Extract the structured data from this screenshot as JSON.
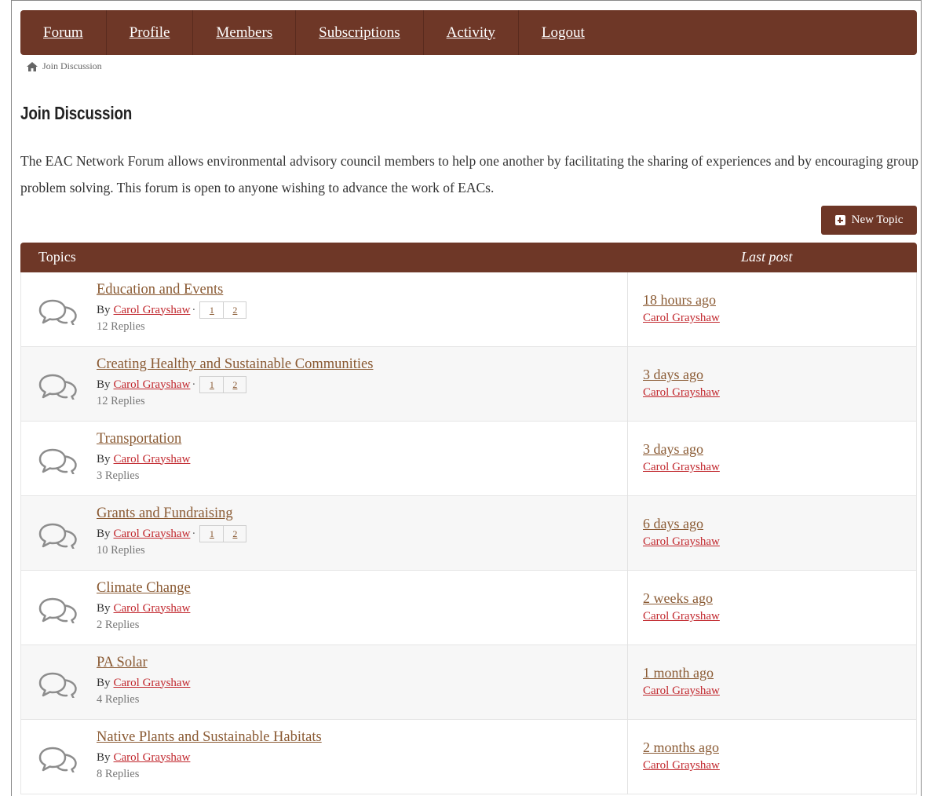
{
  "nav": {
    "items": [
      {
        "label": "Forum"
      },
      {
        "label": "Profile"
      },
      {
        "label": "Members"
      },
      {
        "label": "Subscriptions"
      },
      {
        "label": "Activity"
      },
      {
        "label": "Logout"
      }
    ]
  },
  "breadcrumb": {
    "icon": "home-icon",
    "label": "Join Discussion"
  },
  "page": {
    "title": "Join Discussion",
    "intro": "The EAC Network Forum allows environmental advisory council members to help one another by facilitating the sharing of experiences and by encouraging group problem solving. This forum is open to anyone wishing to advance the work of EACs."
  },
  "new_topic": {
    "label": "New Topic",
    "icon": "plus-square-icon"
  },
  "table": {
    "headers": {
      "topics": "Topics",
      "last_post": "Last post"
    },
    "rows": [
      {
        "title": "Education and Events",
        "by": "By",
        "author": "Carol Grayshaw",
        "pages": [
          "1",
          "2"
        ],
        "replies": "12 Replies",
        "last_time": "18 hours ago",
        "last_author": "Carol Grayshaw"
      },
      {
        "title": "Creating Healthy and Sustainable Communities",
        "by": "By",
        "author": "Carol Grayshaw",
        "pages": [
          "1",
          "2"
        ],
        "replies": "12 Replies",
        "last_time": "3 days ago",
        "last_author": "Carol Grayshaw"
      },
      {
        "title": "Transportation",
        "by": "By",
        "author": "Carol Grayshaw",
        "pages": [],
        "replies": "3 Replies",
        "last_time": "3 days ago",
        "last_author": "Carol Grayshaw"
      },
      {
        "title": "Grants and Fundraising",
        "by": "By",
        "author": "Carol Grayshaw",
        "pages": [
          "1",
          "2"
        ],
        "replies": "10 Replies",
        "last_time": "6 days ago",
        "last_author": "Carol Grayshaw"
      },
      {
        "title": "Climate Change",
        "by": "By",
        "author": "Carol Grayshaw",
        "pages": [],
        "replies": "2 Replies",
        "last_time": "2 weeks ago",
        "last_author": "Carol Grayshaw"
      },
      {
        "title": "PA Solar",
        "by": "By",
        "author": "Carol Grayshaw",
        "pages": [],
        "replies": "4 Replies",
        "last_time": "1 month ago",
        "last_author": "Carol Grayshaw"
      },
      {
        "title": "Native Plants and Sustainable Habitats",
        "by": "By",
        "author": "Carol Grayshaw",
        "pages": [],
        "replies": "8 Replies",
        "last_time": "2 months ago",
        "last_author": "Carol Grayshaw"
      }
    ]
  },
  "colors": {
    "brand": "#6e3727",
    "link": "#8a5a33",
    "author_link": "#c1272d"
  }
}
